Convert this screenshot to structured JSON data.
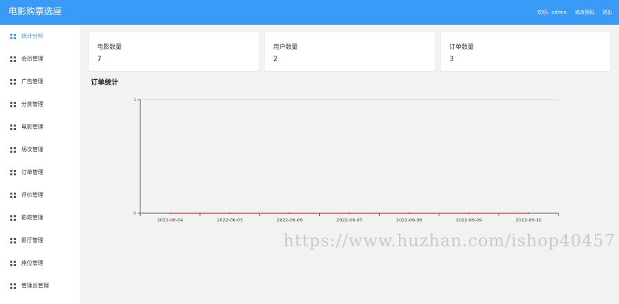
{
  "header": {
    "title": "电影购票选座",
    "welcome": "欢迎，admin",
    "change_password": "修改密码",
    "logout": "退出"
  },
  "sidebar": {
    "items": [
      {
        "label": "统计分析",
        "active": true
      },
      {
        "label": "会员管理"
      },
      {
        "label": "广告管理"
      },
      {
        "label": "分类管理"
      },
      {
        "label": "电影管理"
      },
      {
        "label": "场次管理"
      },
      {
        "label": "订单管理"
      },
      {
        "label": "评价管理"
      },
      {
        "label": "影院管理"
      },
      {
        "label": "影厅管理"
      },
      {
        "label": "座位管理"
      },
      {
        "label": "管理员管理"
      }
    ]
  },
  "stats": [
    {
      "title": "电影数量",
      "value": "7"
    },
    {
      "title": "用户数量",
      "value": "2"
    },
    {
      "title": "订单数量",
      "value": "3"
    }
  ],
  "section": {
    "title": "订单统计"
  },
  "chart_data": {
    "type": "line",
    "x": [
      "2022-06-04",
      "2022-06-05",
      "2022-06-06",
      "2022-06-07",
      "2022-06-08",
      "2022-06-09",
      "2022-06-10"
    ],
    "series": [
      {
        "values": [
          0,
          0,
          0,
          0,
          0,
          0,
          0
        ],
        "color": "#d9534f"
      }
    ],
    "ylim": [
      0,
      1
    ],
    "yticks": [
      "0",
      "1"
    ],
    "grid": true
  },
  "watermark": "https://www.huzhan.com/ishop40457"
}
